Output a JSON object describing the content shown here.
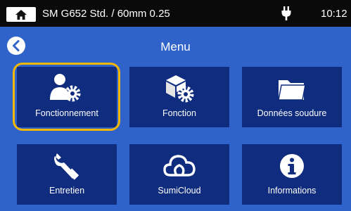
{
  "status": {
    "home_icon": "home-icon",
    "title": "SM G652 Std. / 60mm 0.25",
    "power_icon": "plug-icon",
    "time": "10:12"
  },
  "header": {
    "back_icon": "chevron-left-icon",
    "title": "Menu"
  },
  "tiles": [
    {
      "label": "Fonctionnement",
      "icon": "user-gear-icon",
      "selected": true
    },
    {
      "label": "Fonction",
      "icon": "box-gear-icon",
      "selected": false
    },
    {
      "label": "Données soudure",
      "icon": "folder-icon",
      "selected": false
    },
    {
      "label": "Entretien",
      "icon": "wrench-icon",
      "selected": false
    },
    {
      "label": "SumiCloud",
      "icon": "cloud-icon",
      "selected": false
    },
    {
      "label": "Informations",
      "icon": "info-icon",
      "selected": false
    }
  ],
  "colors": {
    "background": "#2f63c9",
    "tile": "#0f2c7e",
    "selection": "#f3b700",
    "statusbar": "#0a0a0a"
  }
}
